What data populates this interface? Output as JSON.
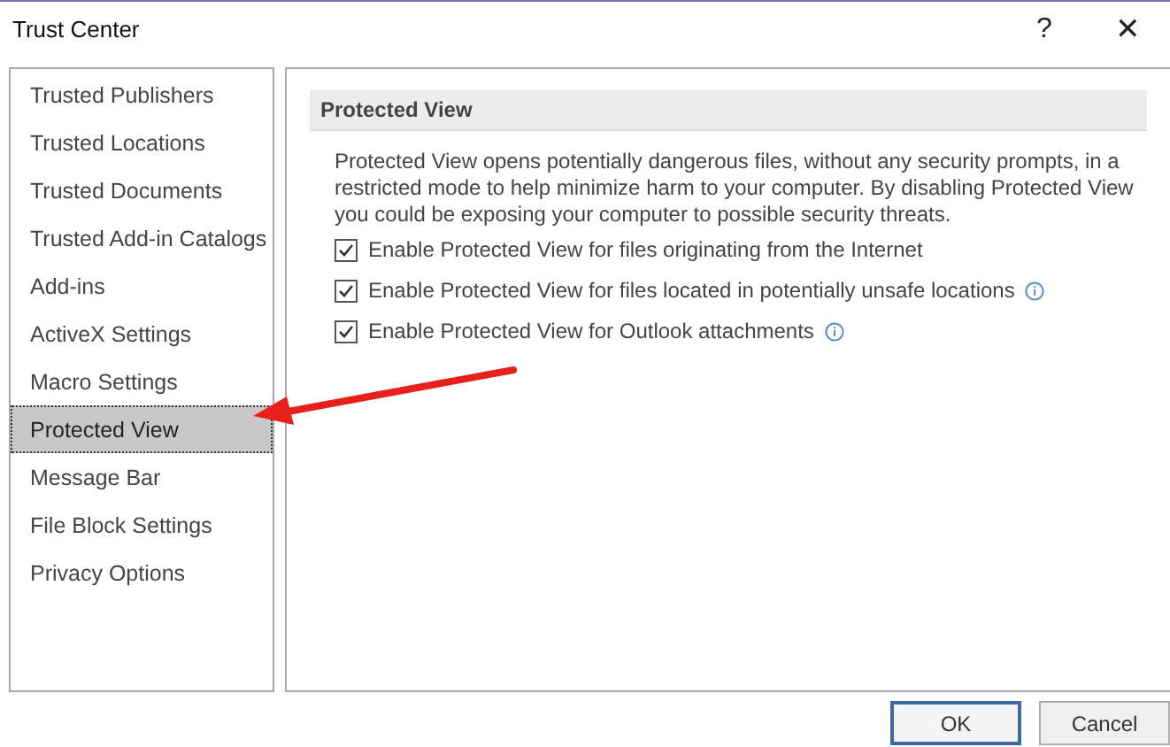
{
  "window": {
    "title": "Trust Center",
    "help": "?",
    "close": "✕"
  },
  "sidebar": {
    "items": [
      {
        "label": "Trusted Publishers",
        "selected": false
      },
      {
        "label": "Trusted Locations",
        "selected": false
      },
      {
        "label": "Trusted Documents",
        "selected": false
      },
      {
        "label": "Trusted Add-in Catalogs",
        "selected": false
      },
      {
        "label": "Add-ins",
        "selected": false
      },
      {
        "label": "ActiveX Settings",
        "selected": false
      },
      {
        "label": "Macro Settings",
        "selected": false
      },
      {
        "label": "Protected View",
        "selected": true
      },
      {
        "label": "Message Bar",
        "selected": false
      },
      {
        "label": "File Block Settings",
        "selected": false
      },
      {
        "label": "Privacy Options",
        "selected": false
      }
    ]
  },
  "section": {
    "title": "Protected View",
    "description": "Protected View opens potentially dangerous files, without any security prompts, in a restricted mode to help minimize harm to your computer. By disabling Protected View you could be exposing your computer to possible security threats.",
    "options": [
      {
        "label": "Enable Protected View for files originating from the Internet",
        "checked": true,
        "info": false
      },
      {
        "label": "Enable Protected View for files located in potentially unsafe locations",
        "checked": true,
        "info": true
      },
      {
        "label": "Enable Protected View for Outlook attachments",
        "checked": true,
        "info": true
      }
    ]
  },
  "buttons": [
    {
      "label": "OK",
      "default": true
    },
    {
      "label": "Cancel",
      "default": false
    }
  ]
}
